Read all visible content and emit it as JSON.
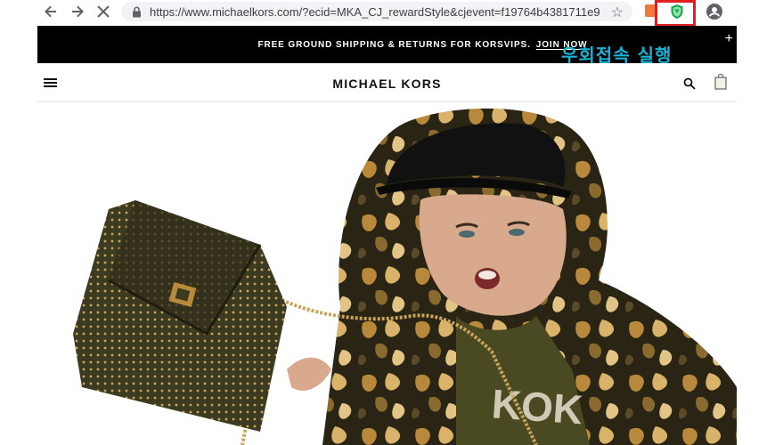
{
  "browser": {
    "url": "https://www.michaelkors.com/?ecid=MKA_CJ_rewardStyle&cjevent=f19764b4381711e9...",
    "icons": {
      "back": "arrow-left",
      "forward": "arrow-right",
      "stop": "close-x",
      "lock": "padlock",
      "bookmark": "star",
      "extension_orange": "extension",
      "extension_shield": "shield",
      "profile": "account-circle"
    },
    "accent_highlight": "#e02020",
    "shield_color": "#1aa34a"
  },
  "promo": {
    "text_prefix": "FREE GROUND SHIPPING & RETURNS FOR ",
    "brand": "KORSVIPS.",
    "link": "JOIN NOW",
    "close_glyph": "+"
  },
  "overlay": {
    "korean_text": "우회접속 실행",
    "color": "#1ab3d6"
  },
  "header": {
    "logo": "MICHAEL KORS",
    "icons": [
      "menu-icon",
      "search-icon",
      "shopping-bag-icon"
    ]
  },
  "hero": {
    "alt": "Model in camouflage hooded jacket holding a studded handbag with chain strap",
    "palette": [
      "#2a2414",
      "#b8893a",
      "#d9b36a",
      "#5b4a28",
      "#111111"
    ]
  }
}
